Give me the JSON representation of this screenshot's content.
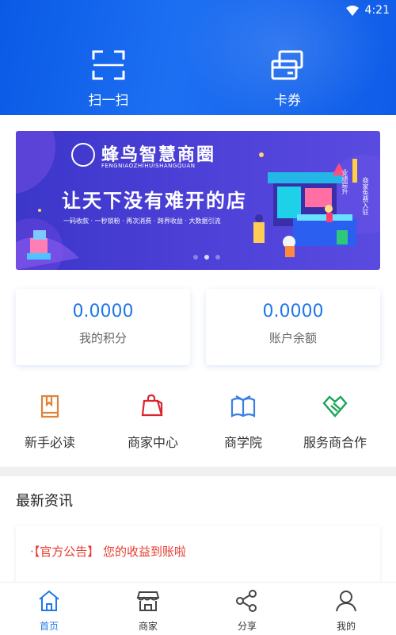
{
  "status_bar": {
    "time": "4:21"
  },
  "header": {
    "scan_label": "扫一扫",
    "coupon_label": "卡券"
  },
  "banner": {
    "brand_title": "蜂鸟智慧商圈",
    "brand_pinyin": "FENGNIAOZHIHUISHANGQUAN",
    "slogan": "让天下没有难开的店",
    "features": "一码收款 · 一秒锁粉 · 再次消费 · 跨界收益 · 大数据引流",
    "side_text_1": "业绩提升",
    "side_text_2": "商家免费入驻",
    "slide_count": 3,
    "active_slide": 2
  },
  "stats": {
    "points_value": "0.0000",
    "points_label": "我的积分",
    "balance_value": "0.0000",
    "balance_label": "账户余额"
  },
  "quick_menu": [
    {
      "label": "新手必读",
      "icon": "book-icon",
      "color": "#e0823a"
    },
    {
      "label": "商家中心",
      "icon": "shopping-bag-icon",
      "color": "#d8262e"
    },
    {
      "label": "商学院",
      "icon": "open-book-icon",
      "color": "#3d7fe0"
    },
    {
      "label": "服务商合作",
      "icon": "handshake-icon",
      "color": "#1aa35a"
    }
  ],
  "news": {
    "title": "最新资讯",
    "items": [
      {
        "text": "·【官方公告】 您的收益到账啦"
      }
    ]
  },
  "tabbar": [
    {
      "label": "首页",
      "icon": "home-icon",
      "active": true
    },
    {
      "label": "商家",
      "icon": "store-icon",
      "active": false
    },
    {
      "label": "分享",
      "icon": "share-icon",
      "active": false
    },
    {
      "label": "我的",
      "icon": "user-icon",
      "active": false
    }
  ],
  "colors": {
    "brand_blue": "#1f78e8",
    "header_blue": "#0f5ce8",
    "news_red": "#e63a2e"
  }
}
